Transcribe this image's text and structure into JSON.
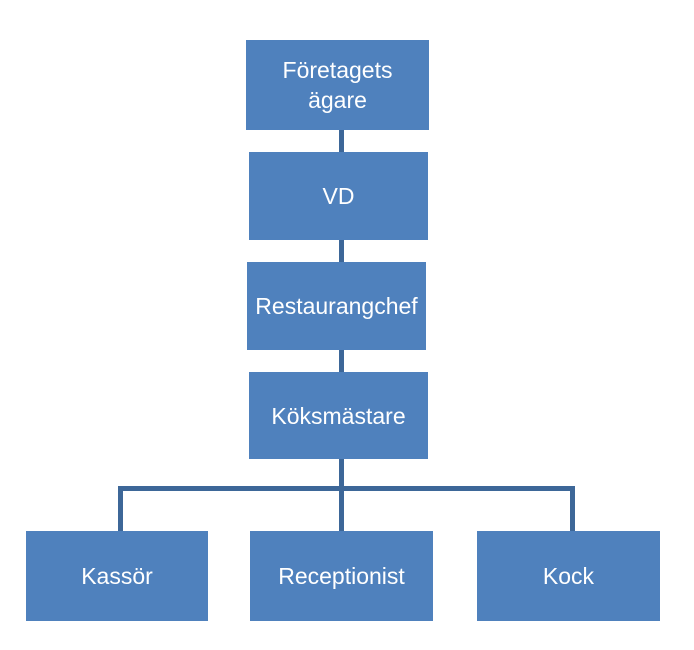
{
  "colors": {
    "box": "#4f81bd",
    "connector": "#3d6798",
    "text": "#ffffff"
  },
  "nodes": {
    "owner": "Företagets ägare",
    "ceo": "VD",
    "restaurant_manager": "Restaurangchef",
    "head_chef": "Köksmästare",
    "cashier": "Kassör",
    "receptionist": "Receptionist",
    "cook": "Kock"
  }
}
